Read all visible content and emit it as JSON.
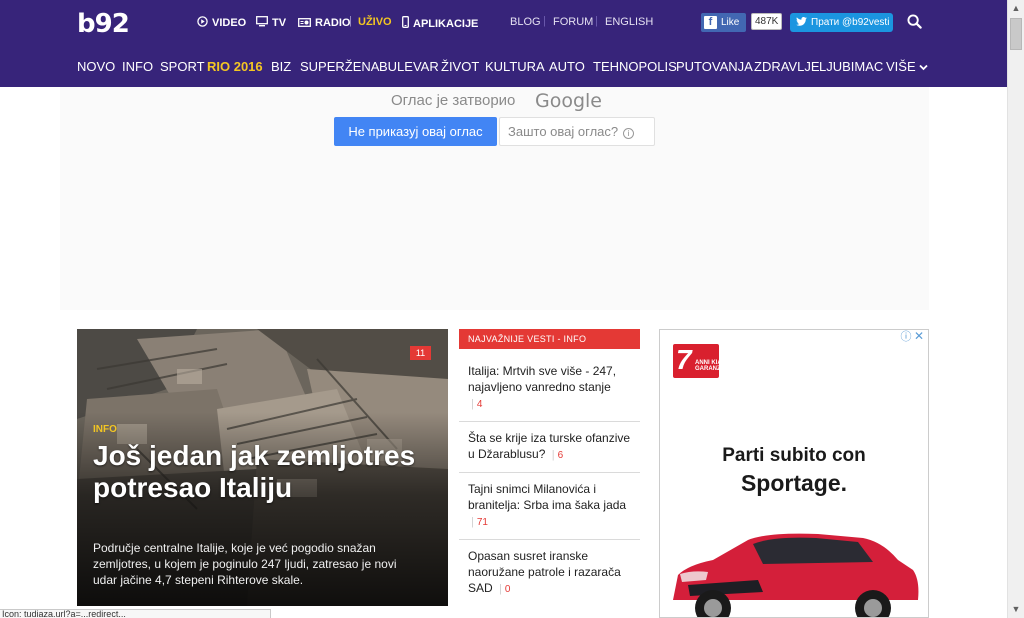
{
  "header": {
    "logo": "b92",
    "media_links": [
      {
        "label": "VIDEO",
        "icon": "play-circle-icon"
      },
      {
        "label": "TV",
        "icon": "monitor-icon"
      },
      {
        "label": "RADIO",
        "icon": "radio-icon"
      },
      {
        "label": "UŽIVO"
      },
      {
        "label": "APLIKACIJE",
        "icon": "mobile-phone-icon"
      }
    ],
    "secondary_links": [
      "BLOG",
      "FORUM",
      "ENGLISH"
    ],
    "facebook": {
      "like_label": "Like",
      "count": "487K"
    },
    "twitter": {
      "follow_label": "Прати @b92vesti"
    },
    "main_nav": [
      "NOVO",
      "INFO",
      "SPORT",
      "RIO 2016",
      "BIZ",
      "SUPERŽENA",
      "BULEVAR",
      "ŽIVOT",
      "KULTURA",
      "AUTO",
      "TEHNOPOLIS",
      "PUTOVANJA",
      "ZDRAVLJE",
      "LJUBIMAC",
      "VIŠE"
    ],
    "active_nav": "RIO 2016",
    "accent_color": "#f3c623",
    "background_color": "#37247a"
  },
  "ad_closed": {
    "text": "Оглас је затворио",
    "google": "Google",
    "hide_button": "Не приказуј овај оглас",
    "why_button": "Зашто овај оглас?"
  },
  "hero": {
    "category": "INFO",
    "comments": "11",
    "title": "Još jedan jak zemljotres potresao Italiju",
    "description": "Područje centralne Italije, koje je već pogodio snažan zemljotres, u kojem je poginulo 247 ljudi, zatresao je novi udar jačine 4,7 stepeni Rihterove skale."
  },
  "latest_news": {
    "header": "NAJVAŽNIJE VESTI - INFO",
    "items": [
      {
        "title": "Italija: Mrtvih sve više - 247, najavljeno vanredno stanje",
        "comments": "4"
      },
      {
        "title": "Šta se krije iza turske ofanzive u Džarablusu?",
        "comments": "6"
      },
      {
        "title": "Tajni snimci Milanovića i branitelja: Srba ima šaka jada",
        "comments": "71"
      },
      {
        "title": "Opasan susret iranske naoružane patrole i razarača SAD",
        "comments": "0"
      }
    ],
    "accent_color": "#e43935"
  },
  "ad_right": {
    "badge_number": "7",
    "badge_text": "ANNI KIA GARANZIA",
    "line1": "Parti subito con",
    "line2": "Sportage."
  },
  "status_bar": {
    "text": "Icon: tudiaza.url?a=...redirect..."
  }
}
